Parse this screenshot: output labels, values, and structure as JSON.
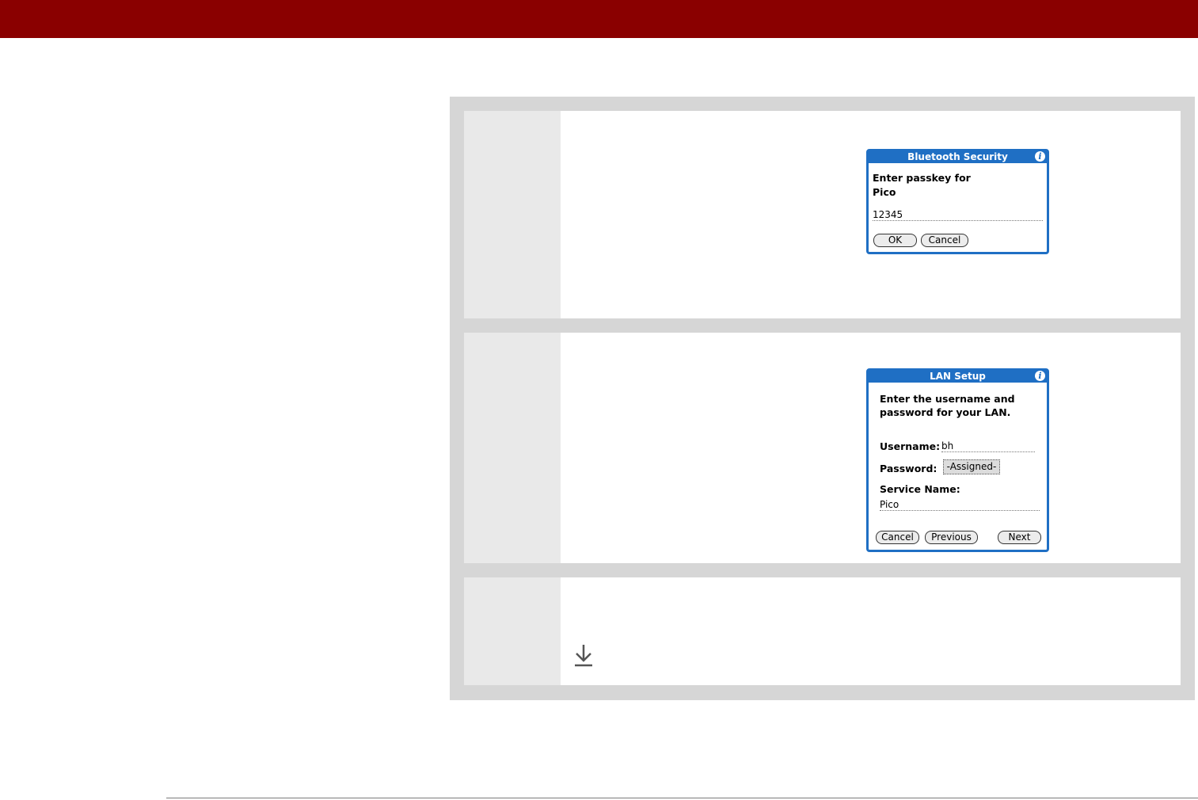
{
  "bluetooth_dialog": {
    "title": "Bluetooth Security",
    "prompt_line1": "Enter passkey for",
    "prompt_line2": "Pico",
    "passkey_value": "12345",
    "ok_label": "OK",
    "cancel_label": "Cancel",
    "icon": "info-icon"
  },
  "lan_dialog": {
    "title": "LAN Setup",
    "prompt_line1": "Enter the username and",
    "prompt_line2": "password for your LAN.",
    "username_label": "Username:",
    "username_value": "bh",
    "password_label": "Password:",
    "password_value": "-Assigned-",
    "service_label": "Service Name:",
    "service_value": "Pico",
    "cancel_label": "Cancel",
    "previous_label": "Previous",
    "next_label": "Next",
    "icon": "info-icon"
  },
  "step3": {
    "icon": "download-arrow-icon"
  },
  "colors": {
    "header_bar": "#8a0000",
    "panel_gray": "#d6d6d6",
    "step_cell_gray": "#e9e9e9",
    "palm_blue": "#1f6fc4"
  }
}
